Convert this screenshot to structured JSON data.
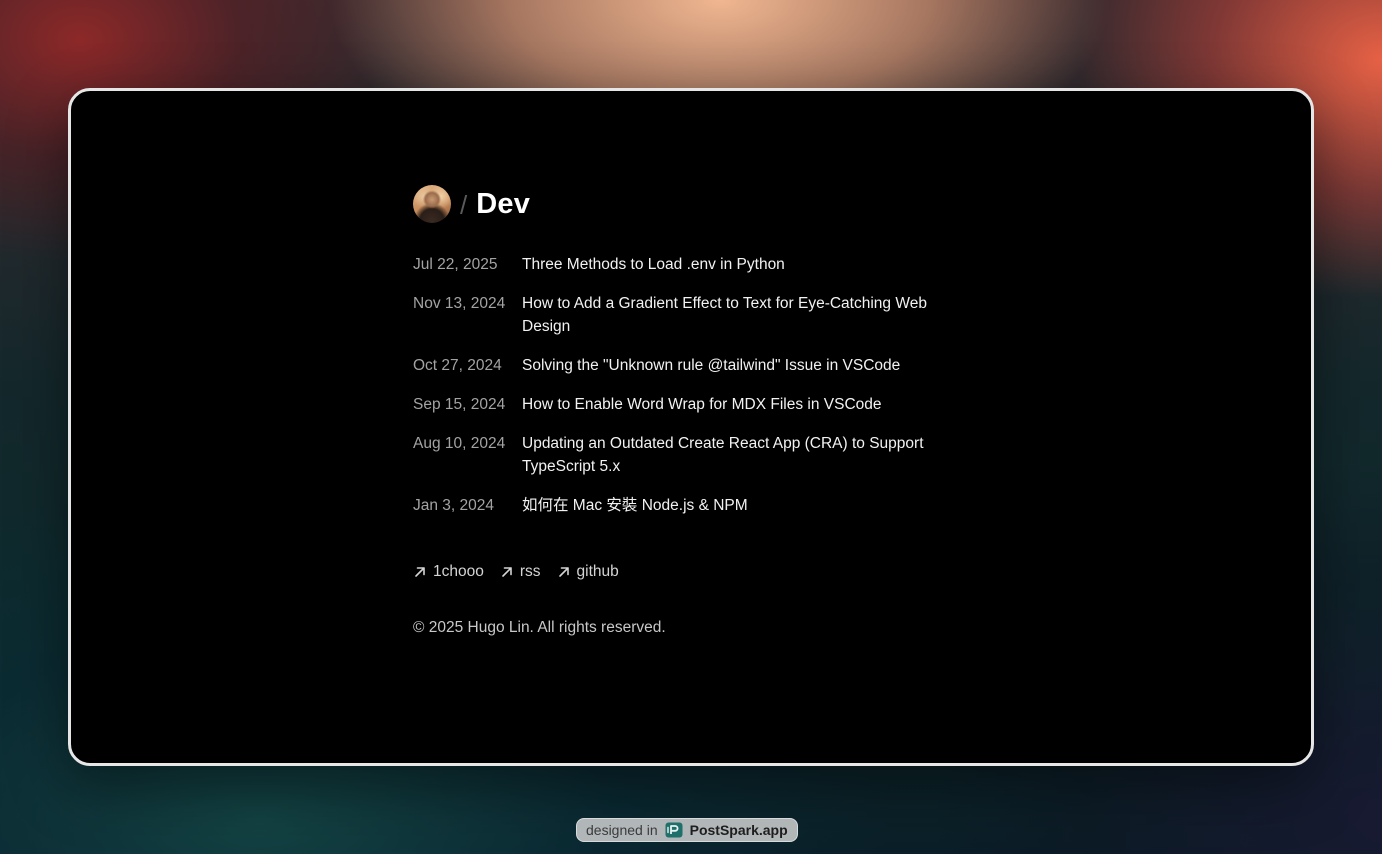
{
  "header": {
    "separator": "/",
    "title": "Dev"
  },
  "posts": [
    {
      "date": "Jul 22, 2025",
      "title": "Three Methods to Load .env in Python"
    },
    {
      "date": "Nov 13, 2024",
      "title": "How to Add a Gradient Effect to Text for Eye-Catching Web Design"
    },
    {
      "date": "Oct 27, 2024",
      "title": "Solving the \"Unknown rule @tailwind\" Issue in VSCode"
    },
    {
      "date": "Sep 15, 2024",
      "title": "How to Enable Word Wrap for MDX Files in VSCode"
    },
    {
      "date": "Aug 10, 2024",
      "title": "Updating an Outdated Create React App (CRA) to Support TypeScript 5.x"
    },
    {
      "date": "Jan 3, 2024",
      "title": "如何在 Mac 安裝 Node.js & NPM"
    }
  ],
  "links": [
    {
      "label": "1chooo",
      "icon": "arrow-up-right-icon"
    },
    {
      "label": "rss",
      "icon": "arrow-up-right-icon"
    },
    {
      "label": "github",
      "icon": "arrow-up-right-icon"
    }
  ],
  "footer": {
    "copyright": "© 2025 Hugo Lin. All rights reserved."
  },
  "badge": {
    "prefix": "designed in",
    "brand": "PostSpark.app"
  },
  "colors": {
    "window_bg": "#000000",
    "window_border": "#e6e6e6",
    "date_text": "#a3a3a3",
    "title_text": "#f2f2f2",
    "badge_logo": "#1f6f6a"
  }
}
